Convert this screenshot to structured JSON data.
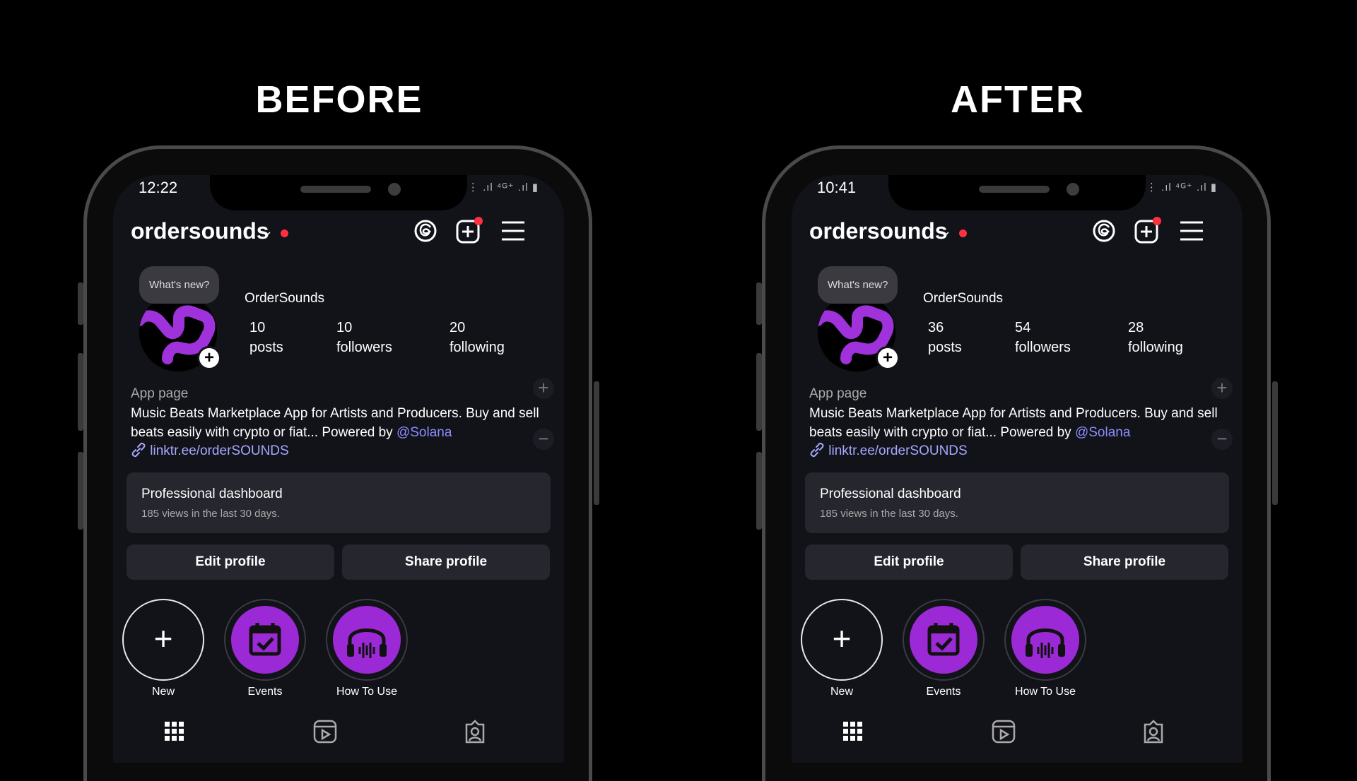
{
  "panels": [
    {
      "title": "BEFORE",
      "status_time": "12:22",
      "status_icons": "💬 ▮   ⋮ .ıl ⁴ᴳ⁺ .ıl ▮",
      "username": "ordersounds",
      "bubble": "What's new?",
      "display_name": "OrderSounds",
      "stats": {
        "posts": {
          "value": "10",
          "label": "posts"
        },
        "followers": {
          "value": "10",
          "label": "followers"
        },
        "following": {
          "value": "20",
          "label": "following"
        }
      },
      "category": "App page",
      "bio_text": "Music Beats Marketplace App for Artists and Producers. Buy and sell beats easily with crypto or fiat... Powered by",
      "bio_mention": "@Solana",
      "link": "linktr.ee/orderSOUNDS",
      "dashboard": {
        "title": "Professional dashboard",
        "subtitle": "185 views in the last 30 days."
      },
      "buttons": {
        "edit": "Edit profile",
        "share": "Share profile"
      },
      "highlights": [
        "New",
        "Events",
        "How To Use"
      ]
    },
    {
      "title": "AFTER",
      "status_time": "10:41",
      "status_icons": "⋮ .ıl ⁴ᴳ⁺ .ıl ▮",
      "username": "ordersounds",
      "bubble": "What's new?",
      "display_name": "OrderSounds",
      "stats": {
        "posts": {
          "value": "36",
          "label": "posts"
        },
        "followers": {
          "value": "54",
          "label": "followers"
        },
        "following": {
          "value": "28",
          "label": "following"
        }
      },
      "category": "App page",
      "bio_text": "Music Beats Marketplace App for Artists and Producers. Buy and sell beats easily with crypto or fiat... Powered by",
      "bio_mention": "@Solana",
      "link": "linktr.ee/orderSOUNDS",
      "dashboard": {
        "title": "Professional dashboard",
        "subtitle": "185 views in the last 30 days."
      },
      "buttons": {
        "edit": "Edit profile",
        "share": "Share profile"
      },
      "highlights": [
        "New",
        "Events",
        "How To Use"
      ]
    }
  ],
  "colors": {
    "accent_purple": "#9b2ad6",
    "link_blue": "#a6a8ff",
    "notification_red": "#ff3040"
  }
}
